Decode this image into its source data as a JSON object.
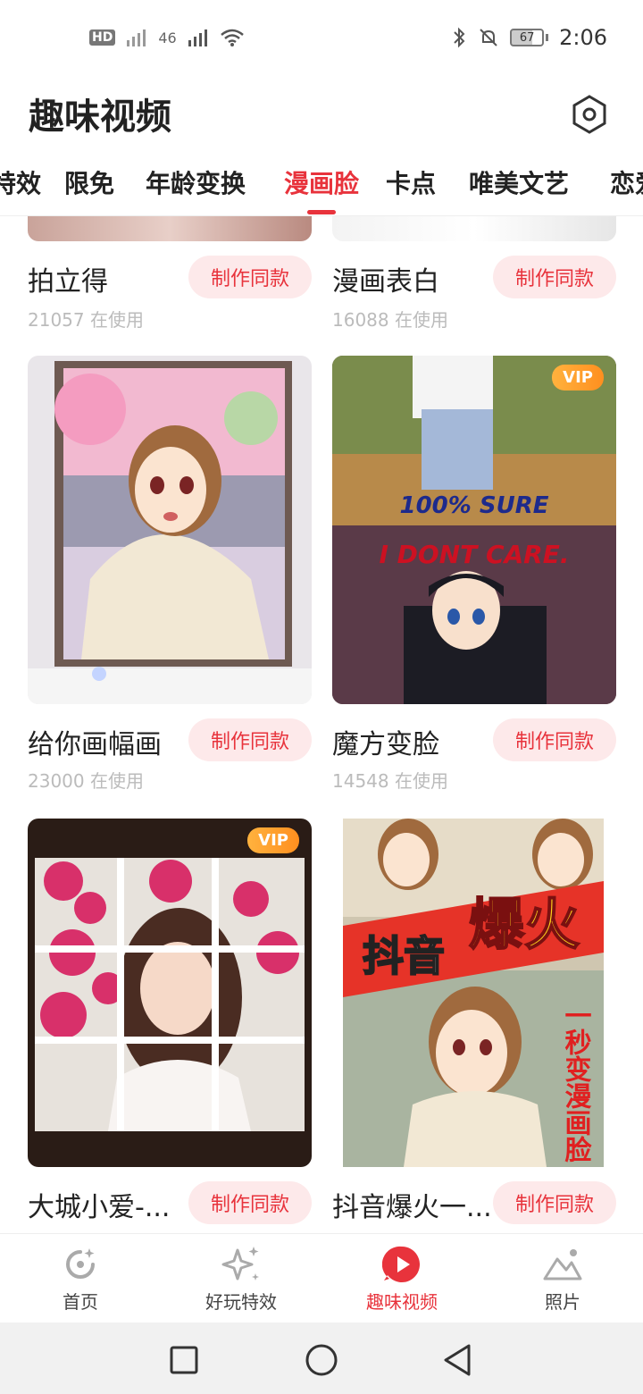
{
  "status_bar": {
    "hd_label": "HD",
    "signal_label": "46",
    "battery_level": "67",
    "time": "2:06"
  },
  "header": {
    "title": "趣味视频"
  },
  "tabs": [
    {
      "label": "特效"
    },
    {
      "label": "限免"
    },
    {
      "label": "年龄变换"
    },
    {
      "label": "漫画脸",
      "active": true
    },
    {
      "label": "卡点"
    },
    {
      "label": "唯美文艺"
    },
    {
      "label": "恋爱"
    }
  ],
  "cards": [
    {
      "title": "拍立得",
      "users": "21057 在使用",
      "button": "制作同款"
    },
    {
      "title": "漫画表白",
      "users": "16088 在使用",
      "button": "制作同款"
    },
    {
      "title": "给你画幅画",
      "users": "23000 在使用",
      "button": "制作同款"
    },
    {
      "title": "魔方变脸",
      "users": "14548 在使用",
      "button": "制作同款",
      "vip": "VIP",
      "overlay_line1": "100% SURE",
      "overlay_line2": "I DONT CARE."
    },
    {
      "title": "大城小爱-...",
      "users": "",
      "button": "制作同款",
      "vip": "VIP"
    },
    {
      "title": "抖音爆火一...",
      "users": "",
      "button": "制作同款",
      "overlay_big1": "抖音",
      "overlay_big2": "爆火",
      "overlay_vert": "一秒变漫画脸"
    }
  ],
  "bottom_nav": [
    {
      "label": "首页",
      "icon": "home-icon"
    },
    {
      "label": "好玩特效",
      "icon": "sparkle-icon"
    },
    {
      "label": "趣味视频",
      "icon": "play-icon",
      "active": true
    },
    {
      "label": "照片",
      "icon": "photo-icon"
    }
  ],
  "colors": {
    "accent": "#e8333c",
    "button_bg": "#fde9ea",
    "vip": "#ff9a2a"
  }
}
